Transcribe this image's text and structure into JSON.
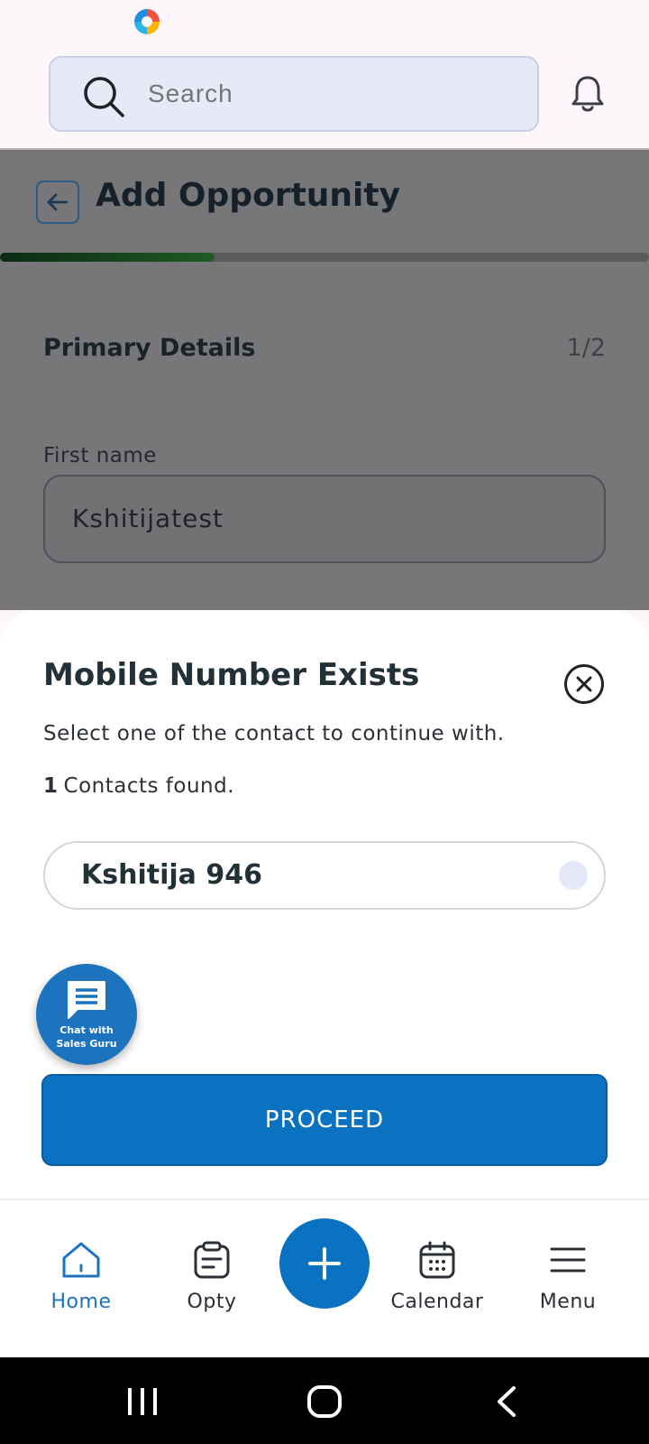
{
  "search": {
    "placeholder": "Search"
  },
  "page": {
    "title": "Add Opportunity",
    "progress": 0.33,
    "section_title": "Primary Details",
    "section_step": "1/2",
    "first_name_label": "First name",
    "first_name_value": "Kshitijatest"
  },
  "dialog": {
    "title": "Mobile Number Exists",
    "description": "Select one of the contact to continue with.",
    "found_count": "1",
    "found_text": "Contacts found.",
    "contacts": [
      {
        "name": "Kshitija 946",
        "selected": false
      }
    ],
    "proceed_label": "PROCEED"
  },
  "chat": {
    "line1": "Chat with",
    "line2": "Sales Guru"
  },
  "bottom_nav": {
    "items": [
      {
        "label": "Home",
        "icon": "home-icon",
        "active": true
      },
      {
        "label": "Opty",
        "icon": "clipboard-icon",
        "active": false
      },
      {
        "label": "Calendar",
        "icon": "calendar-icon",
        "active": false
      },
      {
        "label": "Menu",
        "icon": "menu-icon",
        "active": false
      }
    ],
    "add_icon": "plus-icon"
  },
  "colors": {
    "primary": "#0b72c1",
    "progress": "#1f5a25",
    "overlay": "#777779"
  }
}
